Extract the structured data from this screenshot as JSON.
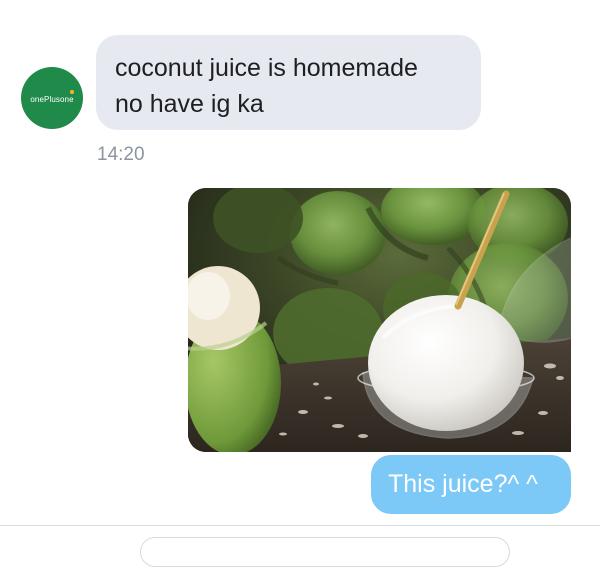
{
  "contact": {
    "avatar_text": "onePlusone",
    "icon": "oneplusone-logo"
  },
  "incoming": {
    "lines": [
      "coconut juice is homemade",
      "no have ig ka"
    ],
    "time": "14:20"
  },
  "outgoing": {
    "image_icon": "coconut-photo",
    "text": "This juice?^ ^"
  },
  "colors": {
    "incoming_bubble": "#e6e9ef",
    "outgoing_bubble": "#7cc8f6",
    "avatar_bg": "#1f8a4a",
    "timestamp": "#8b95a0"
  }
}
